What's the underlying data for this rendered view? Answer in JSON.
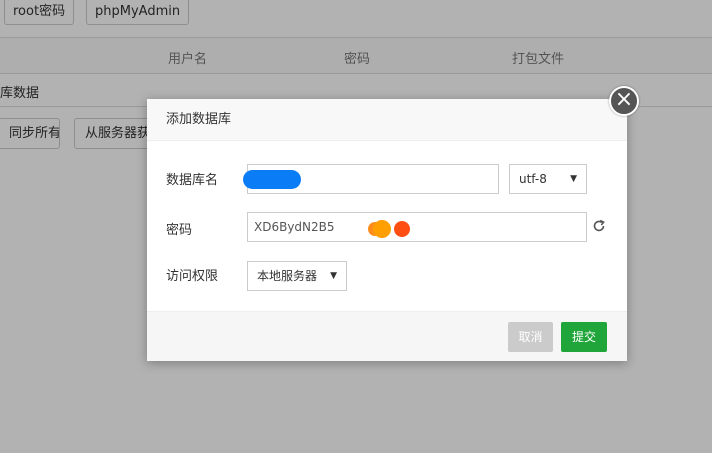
{
  "background": {
    "top_buttons": [
      "root密码",
      "phpMyAdmin"
    ],
    "columns": [
      "用户名",
      "密码",
      "打包文件"
    ],
    "row_text": "库数据",
    "bottom_buttons": [
      "同步所有",
      "从服务器获取"
    ]
  },
  "dialog": {
    "title": "添加数据库",
    "close_glyph": "×",
    "fields": {
      "db_name_label": "数据库名",
      "db_name_value": "",
      "charset_value": "utf-8",
      "password_label": "密码",
      "password_value": "XD6BydN2B5",
      "access_label": "访问权限",
      "access_value": "本地服务器"
    },
    "buttons": {
      "cancel": "取消",
      "submit": "提交"
    }
  },
  "colors": {
    "submit": "#20a53a",
    "cancel": "#cbcbcb",
    "redaction_blue": "#0a7cf5",
    "redaction_orange": "#ffa000",
    "redaction_red": "#ff4e11"
  },
  "icons": {
    "refresh": "refresh-icon",
    "close": "close-icon",
    "caret": "caret-down-icon"
  }
}
